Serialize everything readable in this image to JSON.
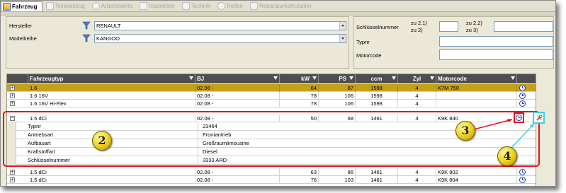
{
  "tabs": [
    {
      "label": "Fahrzeug",
      "icon": "car-icon",
      "active": true
    },
    {
      "label": "Teilekatalog",
      "icon": "catalog-icon",
      "active": false
    },
    {
      "label": "Arbeitswerte",
      "icon": "clock-icon",
      "active": false
    },
    {
      "label": "Inspektion",
      "icon": "inspection-icon",
      "active": false
    },
    {
      "label": "Technik",
      "icon": "technik-icon",
      "active": false
    },
    {
      "label": "Reifen",
      "icon": "tire-icon",
      "active": false
    },
    {
      "label": "Reparaturkalkulation",
      "icon": "calculator-icon",
      "active": false
    }
  ],
  "filter": {
    "hersteller_label": "Hersteller",
    "hersteller_value": "RENAULT",
    "modellreihe_label": "Modellreihe",
    "modellreihe_value": "KANGOO"
  },
  "search": {
    "schluessel_label": "Schlüsselnummer",
    "zu21_label": "zu 2.1)",
    "zu2_label": "zu 2)",
    "zu22_label": "zu 2.2)",
    "zu3_label": "zu 3)",
    "typnr_label": "Typnr",
    "motorcode_label": "Motorcode"
  },
  "grid": {
    "columns": [
      "Fahrzeugtyp",
      "BJ",
      "kW",
      "PS",
      "ccm",
      "Zyl",
      "Motorcode"
    ],
    "rows": [
      {
        "typ": "1.6",
        "bj": "02.08 -",
        "kw": "64",
        "ps": "87",
        "ccm": "1598",
        "zyl": "4",
        "motor": "K7M 750",
        "selected": true
      },
      {
        "typ": "1.6 16V",
        "bj": "02.08 -",
        "kw": "78",
        "ps": "106",
        "ccm": "1598",
        "zyl": "4",
        "motor": "",
        "selected": false
      },
      {
        "typ": "1.6 16V  Hi-Flex",
        "bj": "02.08 -",
        "kw": "78",
        "ps": "106",
        "ccm": "1598",
        "zyl": "4",
        "motor": "",
        "selected": false
      },
      {
        "typ": "1.5 dCi",
        "bj": "02.08 -",
        "kw": "50",
        "ps": "68",
        "ccm": "1461",
        "zyl": "4",
        "motor": "K9K 840",
        "selected": false
      },
      {
        "typ": "1.5 dCi",
        "bj": "02.08 -",
        "kw": "63",
        "ps": "86",
        "ccm": "1461",
        "zyl": "4",
        "motor": "K9K 802",
        "selected": false
      },
      {
        "typ": "1.5 dCi",
        "bj": "02.08 -",
        "kw": "76",
        "ps": "103",
        "ccm": "1461",
        "zyl": "4",
        "motor": "K9K 804",
        "selected": false
      }
    ],
    "details": [
      {
        "key": "Typnr",
        "value": "23464"
      },
      {
        "key": "Antriebsart",
        "value": "Frontantrieb"
      },
      {
        "key": "Aufbauart",
        "value": "Großraumlimousine"
      },
      {
        "key": "Kraftstoffart",
        "value": "Diesel"
      },
      {
        "key": "Schlüsselnummer",
        "value": "3333 ARD"
      }
    ]
  },
  "annotations": {
    "badge2": "2",
    "badge3": "3",
    "badge4": "4"
  },
  "colors": {
    "selected_row": "#c5a11a",
    "header": "#4e4e4e",
    "annotation_red": "#e1141e",
    "annotation_cyan": "#39d3de"
  }
}
